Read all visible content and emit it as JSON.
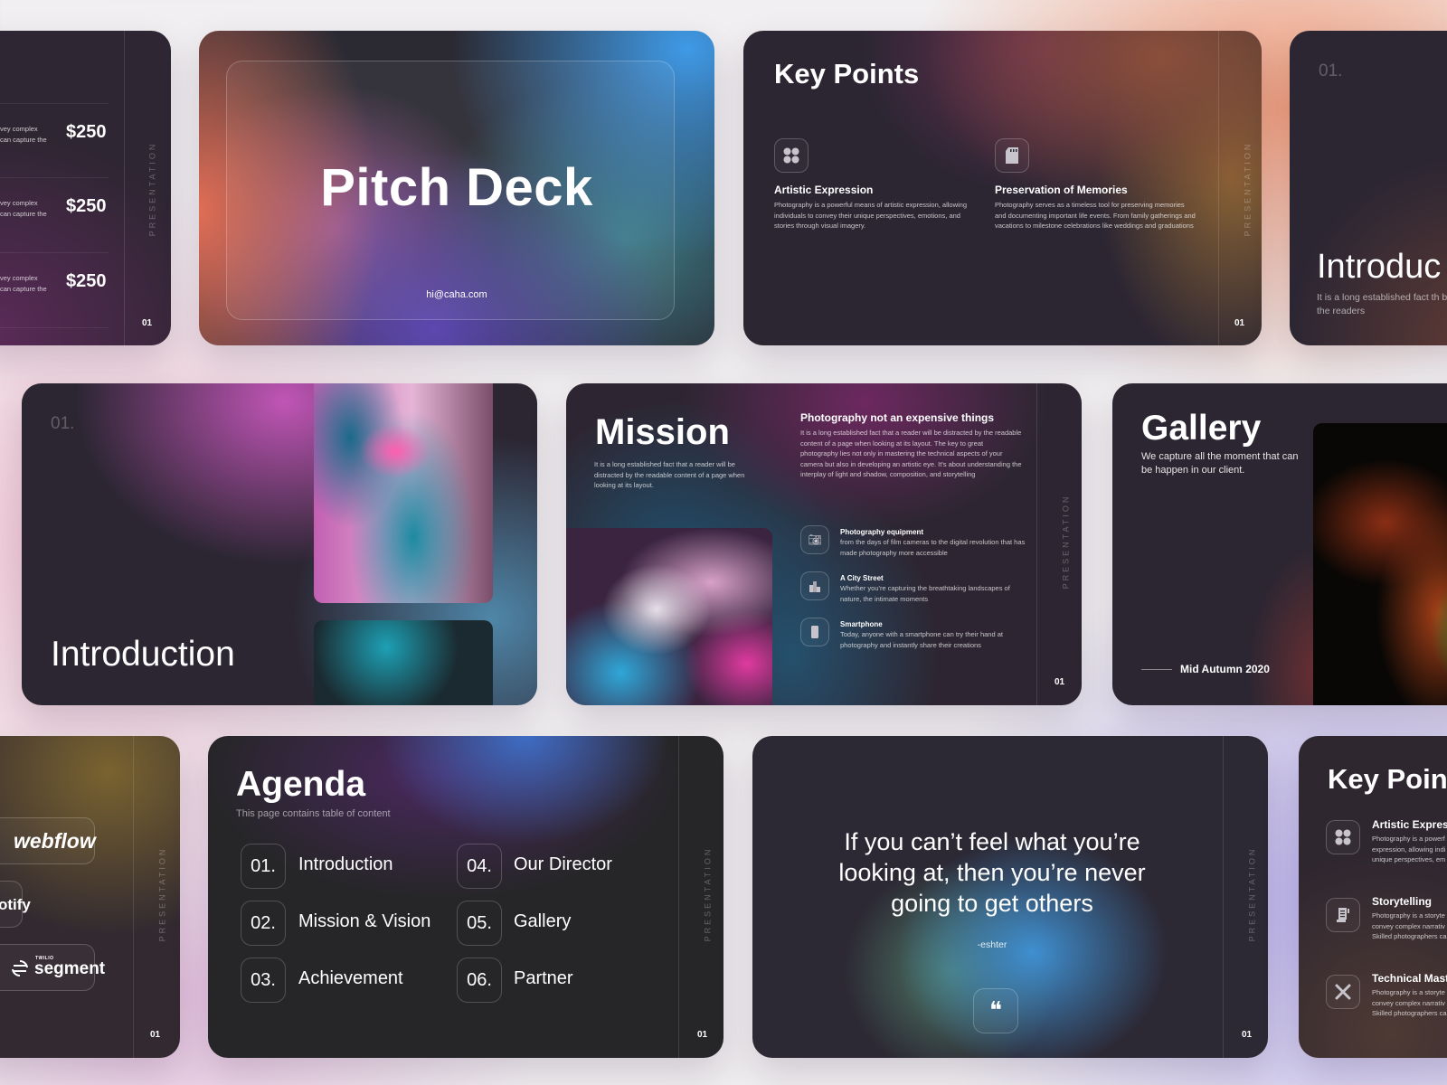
{
  "common": {
    "vertical_label": "PRESENTATION",
    "page_number": "01"
  },
  "pricing_slide": {
    "rows": [
      {
        "text_line1": "vey complex",
        "text_line2": "can capture the",
        "price": "$250"
      },
      {
        "text_line1": "vey complex",
        "text_line2": "can capture the",
        "price": "$250"
      },
      {
        "text_line1": "vey complex",
        "text_line2": "can capture the",
        "price": "$250"
      }
    ]
  },
  "pitch_slide": {
    "title": "Pitch Deck",
    "email": "hi@caha.com"
  },
  "key_points_slide": {
    "title": "Key Points",
    "items": [
      {
        "icon": "emotions-icon",
        "heading": "Artistic Expression",
        "body": "Photography is a powerful means of artistic expression, allowing individuals to convey their unique perspectives, emotions, and stories through visual imagery."
      },
      {
        "icon": "sd-card-icon",
        "heading": "Preservation of Memories",
        "body": "Photography serves as a timeless tool for preserving memories and documenting important life events. From family gatherings and vacations to milestone celebrations like weddings and graduations"
      }
    ]
  },
  "intro_partial_slide": {
    "number": "01.",
    "title": "Introduc",
    "body": "It is a long established fact th be the readers"
  },
  "introduction_slide": {
    "number": "01.",
    "title": "Introduction"
  },
  "mission_slide": {
    "title": "Mission",
    "intro": "It is a long established fact that a reader will be distracted by the readable content of a page when looking at its layout.",
    "subheading": "Photography not an expensive things",
    "subbody": "It is a long established fact that a reader will be distracted by the readable content of a page when looking at its layout. The key to great photography lies not only in mastering the technical aspects of your camera but also in developing an artistic eye. It's about understanding the interplay of light and shadow, composition, and storytelling",
    "items": [
      {
        "icon": "camera-icon",
        "heading": "Photography equipment",
        "body": "from the days of film cameras to the digital revolution that has made photography more accessible"
      },
      {
        "icon": "city-icon",
        "heading": "A City Street",
        "body": "Whether you're capturing the breathtaking landscapes of nature, the intimate moments"
      },
      {
        "icon": "smartphone-icon",
        "heading": "Smartphone",
        "body": "Today, anyone with a smartphone can try their hand at photography and instantly share their creations"
      }
    ]
  },
  "gallery_slide": {
    "title": "Gallery",
    "subtitle": "We capture all the moment that can be happen in our client.",
    "caption": "Mid Autumn 2020"
  },
  "partners_slide": {
    "logos": [
      "webflow",
      "otify",
      "segment"
    ],
    "segment_prefix": "TWILIO"
  },
  "agenda_slide": {
    "title": "Agenda",
    "subtitle": "This page contains table of content",
    "items": [
      {
        "num": "01.",
        "label": "Introduction"
      },
      {
        "num": "02.",
        "label": "Mission & Vision"
      },
      {
        "num": "03.",
        "label": "Achievement"
      },
      {
        "num": "04.",
        "label": "Our Director"
      },
      {
        "num": "05.",
        "label": "Gallery"
      },
      {
        "num": "06.",
        "label": "Partner"
      }
    ]
  },
  "quote_slide": {
    "quote": "If you can’t feel what you’re looking at, then you’re never going to get others",
    "author": "-eshter",
    "quote_mark": "❝"
  },
  "key_points_2_slide": {
    "title": "Key Poin",
    "items": [
      {
        "icon": "emotions-icon",
        "heading": "Artistic Express",
        "body": "Photography is a powerf expression, allowing indi unique perspectives, em"
      },
      {
        "icon": "script-icon",
        "heading": "Storytelling",
        "body": "Photography is a storyte convey complex narrativ Skilled photographers ca"
      },
      {
        "icon": "tools-icon",
        "heading": "Technical Mast",
        "body": "Photography is a storyte convey complex narrativ Skilled photographers ca"
      }
    ]
  }
}
